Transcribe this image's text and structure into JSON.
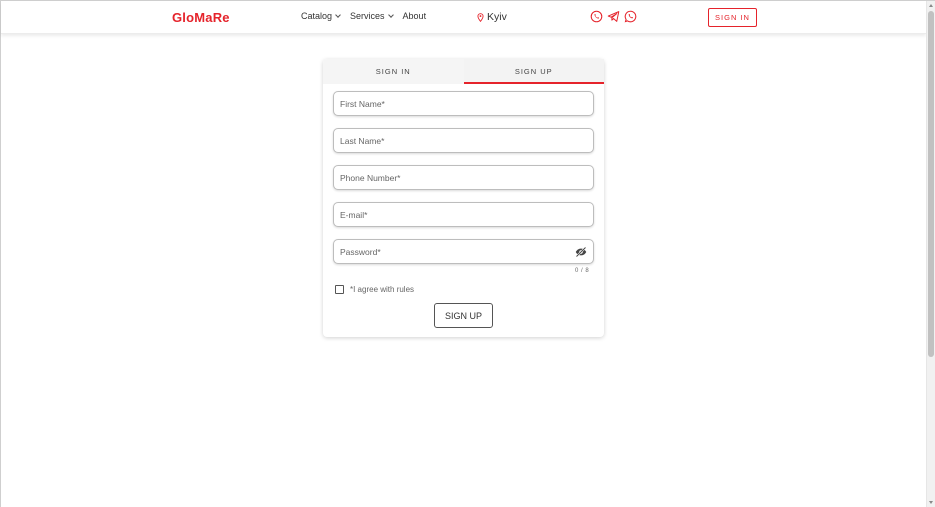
{
  "header": {
    "logo": "GloMaRe",
    "nav": [
      {
        "label": "Catalog",
        "has_dropdown": true
      },
      {
        "label": "Services",
        "has_dropdown": true
      },
      {
        "label": "About",
        "has_dropdown": false
      }
    ],
    "city": "Kyiv",
    "city_icon": "location-pin-icon",
    "socials": [
      "viber-icon",
      "telegram-icon",
      "whatsapp-icon"
    ],
    "signin_label": "SIGN IN",
    "accent_color": "#e5232b"
  },
  "card": {
    "tabs": [
      {
        "label": "SIGN IN",
        "active": false
      },
      {
        "label": "SIGN UP",
        "active": true
      }
    ],
    "fields": {
      "first_name": {
        "placeholder": "First Name*",
        "value": ""
      },
      "last_name": {
        "placeholder": "Last Name*",
        "value": ""
      },
      "phone": {
        "placeholder": "Phone Number*",
        "value": ""
      },
      "email": {
        "placeholder": "E-mail*",
        "value": ""
      },
      "password": {
        "placeholder": "Password*",
        "value": "",
        "icon": "eye-off-icon"
      }
    },
    "password_counter": "0 / 8",
    "agree_label": "*I agree with rules",
    "agree_checked": false,
    "submit_label": "SIGN UP"
  }
}
